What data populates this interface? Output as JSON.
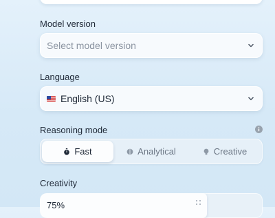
{
  "model_version": {
    "label": "Model version",
    "placeholder": "Select model version",
    "icon": "chevron-down-icon"
  },
  "language": {
    "label": "Language",
    "value": "English (US)",
    "flag_icon": "us-flag-icon",
    "icon": "chevron-down-icon"
  },
  "reasoning_mode": {
    "label": "Reasoning mode",
    "info_icon": "info-icon",
    "options": [
      {
        "label": "Fast",
        "icon": "stopwatch-icon",
        "selected": true
      },
      {
        "label": "Analytical",
        "icon": "brain-icon",
        "selected": false
      },
      {
        "label": "Creative",
        "icon": "lightbulb-icon",
        "selected": false
      }
    ]
  },
  "creativity": {
    "label": "Creativity",
    "value": "75%",
    "level": 0.75,
    "handle_icon": "drag-handle-icon"
  },
  "colors": {
    "background": "#dcecf8",
    "accent_text": "#1f2937",
    "muted_text": "#6b7684"
  }
}
